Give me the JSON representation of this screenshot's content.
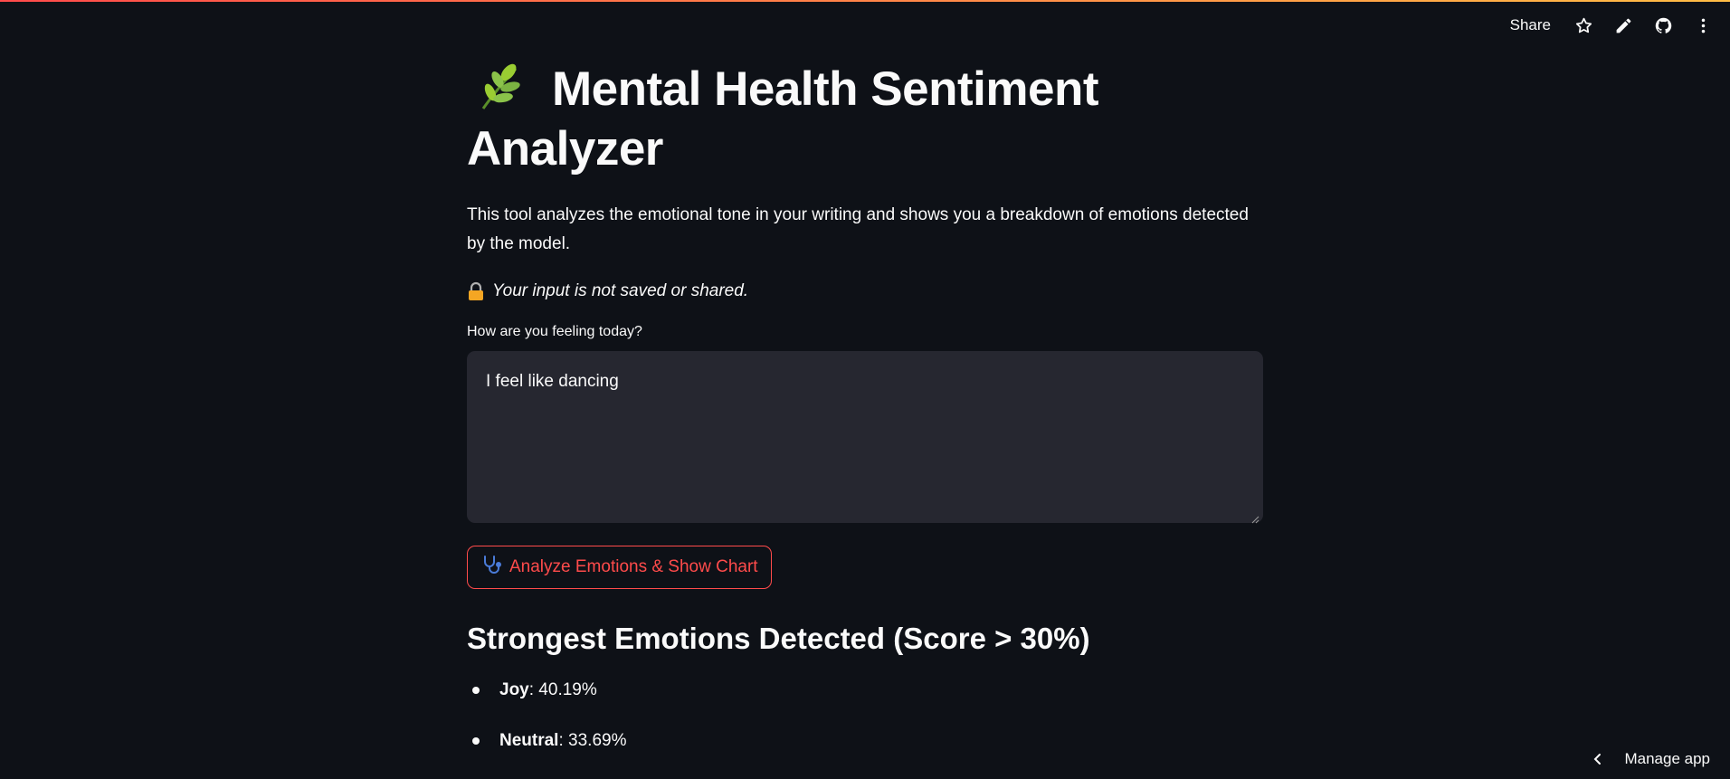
{
  "toolbar": {
    "share_label": "Share",
    "icons": [
      "star-icon",
      "pencil-icon",
      "github-icon",
      "more-vertical-icon"
    ]
  },
  "header": {
    "title_line1": "Mental Health Sentiment",
    "title_line2": "Analyzer",
    "emoji": "herb-icon"
  },
  "intro": {
    "description": "This tool analyzes the emotional tone in your writing and shows you a breakdown of emotions detected by the model.",
    "privacy_note": "Your input is not saved or shared."
  },
  "input": {
    "label": "How are you feeling today?",
    "value": "I feel like dancing"
  },
  "analyze_button": {
    "label": "Analyze Emotions & Show Chart",
    "icon": "stethoscope-icon"
  },
  "results": {
    "title": "Strongest Emotions Detected (Score > 30%)",
    "items": [
      {
        "name": "Joy",
        "score": ": 40.19%"
      },
      {
        "name": "Neutral",
        "score": ": 33.69%"
      }
    ]
  },
  "footer": {
    "manage_label": "Manage app"
  },
  "colors": {
    "background": "#0e1117",
    "text": "#fafafa",
    "input_bg": "#262730",
    "accent": "#ff4b4b"
  }
}
